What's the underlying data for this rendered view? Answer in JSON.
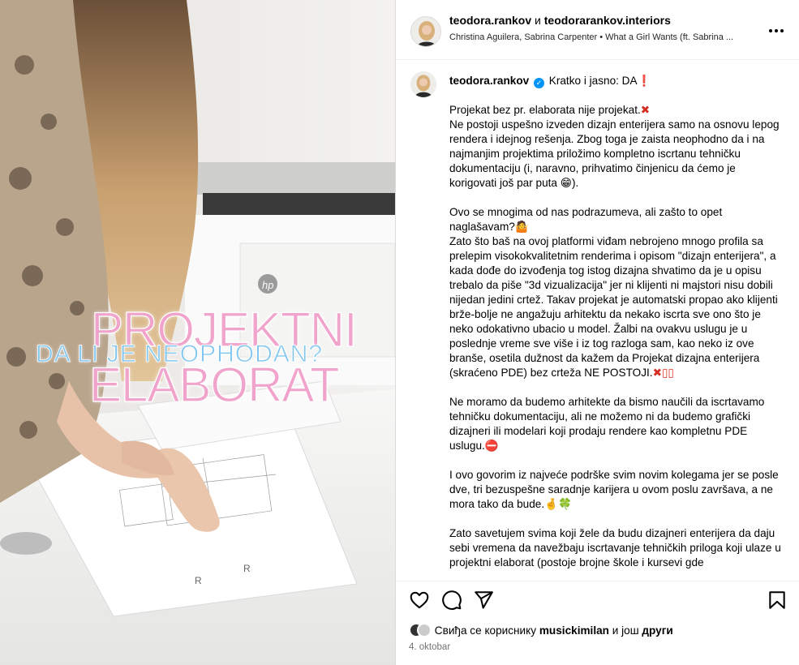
{
  "media": {
    "overlay_line1": "PROJEKTNI",
    "overlay_line2": "DA LI JE NEOPHODAN?",
    "overlay_line3": "ELABORAT"
  },
  "header": {
    "user1": "teodora.rankov",
    "conjunction": "и",
    "user2": "teodorarankov.interiors",
    "audio": "Christina Aguilera, Sabrina Carpenter • What a Girl Wants (ft. Sabrina ..."
  },
  "caption": {
    "username": "teodora.rankov",
    "intro": "Kratko i jasno: DA",
    "intro_emoji": "❗",
    "p1": "Projekat bez pr. elaborata nije projekat.",
    "p1_emoji": "✖",
    "p1b": "Ne postoji uspešno izveden dizajn enterijera samo na osnovu lepog rendera i idejnog rešenja. Zbog toga je zaista neophodno da i na najmanjim projektima priložimo kompletno iscrtanu tehničku dokumentaciju (i, naravno, prihvatimo činjenicu da ćemo je korigovati još par puta",
    "p1b_emoji": "😁",
    "p1b_end": ").",
    "p2": "Ovo se mnogima od nas podrazumeva, ali zašto to opet naglašavam?",
    "p2_emoji": "🤷",
    "p2b": "Zato što baš na ovoj platformi viđam nebrojeno mnogo profila sa prelepim visokokvalitetnim renderima i opisom \"dizajn enterijera\", a kada dođe do izvođenja tog istog dizajna shvatimo da je u opisu trebalo da piše \"3d vizualizacija\" jer ni klijenti ni majstori nisu dobili nijedan jedini crtež. Takav projekat je automatski propao ako klijenti brže-bolje ne angažuju arhitektu da nekako iscrta sve ono što je neko odokativno ubacio u model. Žalbi na ovakvu uslugu je u poslednje vreme sve više i iz tog razloga sam, kao neko iz ove branše, osetila dužnost da kažem da Projekat dizajna enterijera (skraćeno PDE) bez crteža NE POSTOJI.",
    "p2b_emoji": "✖▯▯",
    "p3": "Ne moramo da budemo arhitekte da bismo naučili da iscrtavamo tehničku dokumentaciju, ali ne možemo ni da budemo grafički dizajneri ili modelari koji prodaju rendere kao kompletnu PDE uslugu.",
    "p3_emoji": "⛔",
    "p4": "I ovo govorim iz najveće podrške svim novim kolegama jer se posle dve, tri bezuspešne saradnje karijera u ovom poslu završava, a ne mora tako da bude.",
    "p4_emoji": "🤞🍀",
    "p5": "Zato savetujem svima koji žele da budu dizajneri enterijera da daju sebi vremena da navežbaju iscrtavanje tehničkih priloga koji ulaze u projektni elaborat (postoje brojne škole i kursevi gde"
  },
  "likes": {
    "prefix": "Свиђа се кориснику",
    "user": "musickimilan",
    "middle": "и још",
    "others": "други"
  },
  "date": "4. oktobar",
  "colors": {
    "verified": "#0095f6",
    "title_pink": "#f0a4cb",
    "subtitle_blue": "#7ec5ef",
    "secondary_text": "#737373"
  }
}
